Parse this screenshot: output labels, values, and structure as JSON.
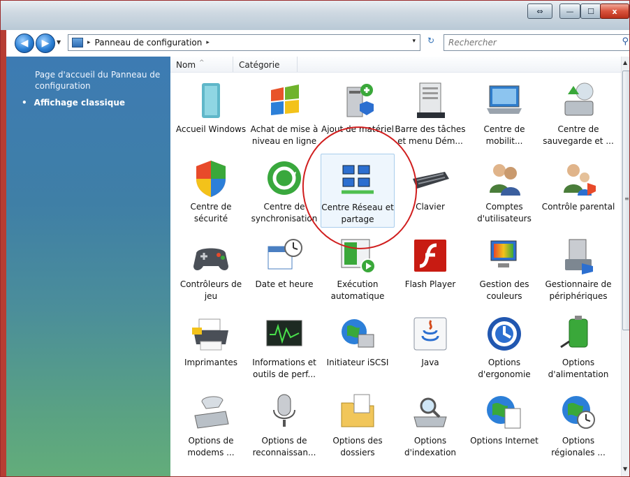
{
  "window": {
    "controls": {
      "restore_view": "⇔",
      "minimize": "—",
      "maximize": "☐",
      "close": "x"
    }
  },
  "address": {
    "path": "Panneau de configuration",
    "separator": "▸",
    "dropdown": "▾"
  },
  "search": {
    "placeholder": "Rechercher"
  },
  "left_pane": {
    "home_link": "Page d'accueil du Panneau de configuration",
    "bullet": "•",
    "classic_view": "Affichage classique"
  },
  "columns": {
    "name": "Nom",
    "category": "Catégorie"
  },
  "items": [
    {
      "label": "Accueil Windows",
      "icon": "welcome-center-icon"
    },
    {
      "label": "Achat de mise à niveau en ligne",
      "icon": "windows-flag-icon"
    },
    {
      "label": "Ajout de matériel",
      "icon": "add-hardware-icon"
    },
    {
      "label": "Barre des tâches et menu Dém...",
      "icon": "taskbar-icon"
    },
    {
      "label": "Centre de mobilit...",
      "icon": "mobility-center-icon"
    },
    {
      "label": "Centre de sauvegarde et ...",
      "icon": "backup-icon"
    },
    {
      "label": "Centre de sécurité",
      "icon": "security-shield-icon"
    },
    {
      "label": "Centre de synchronisation",
      "icon": "sync-icon"
    },
    {
      "label": "Centre Réseau et partage",
      "icon": "network-icon"
    },
    {
      "label": "Clavier",
      "icon": "keyboard-icon"
    },
    {
      "label": "Comptes d'utilisateurs",
      "icon": "user-accounts-icon"
    },
    {
      "label": "Contrôle parental",
      "icon": "parental-controls-icon"
    },
    {
      "label": "Contrôleurs de jeu",
      "icon": "gamepad-icon"
    },
    {
      "label": "Date et heure",
      "icon": "calendar-clock-icon"
    },
    {
      "label": "Exécution automatique",
      "icon": "autoplay-icon"
    },
    {
      "label": "Flash Player",
      "icon": "flash-icon"
    },
    {
      "label": "Gestion des couleurs",
      "icon": "color-management-icon"
    },
    {
      "label": "Gestionnaire de périphériques",
      "icon": "device-manager-icon"
    },
    {
      "label": "Imprimantes",
      "icon": "printer-icon"
    },
    {
      "label": "Informations et outils de perf...",
      "icon": "performance-icon"
    },
    {
      "label": "Initiateur iSCSI",
      "icon": "iscsi-globe-icon"
    },
    {
      "label": "Java",
      "icon": "java-icon"
    },
    {
      "label": "Options d'ergonomie",
      "icon": "ease-of-access-icon"
    },
    {
      "label": "Options d'alimentation",
      "icon": "power-options-icon"
    },
    {
      "label": "Options de modems ...",
      "icon": "modem-phone-icon"
    },
    {
      "label": "Options de reconnaissan...",
      "icon": "microphone-icon"
    },
    {
      "label": "Options des dossiers",
      "icon": "folder-options-icon"
    },
    {
      "label": "Options d'indexation",
      "icon": "indexing-icon"
    },
    {
      "label": "Options Internet",
      "icon": "internet-options-icon"
    },
    {
      "label": "Options régionales ...",
      "icon": "regional-globe-icon"
    }
  ],
  "selected_item": "Centre Réseau et partage"
}
